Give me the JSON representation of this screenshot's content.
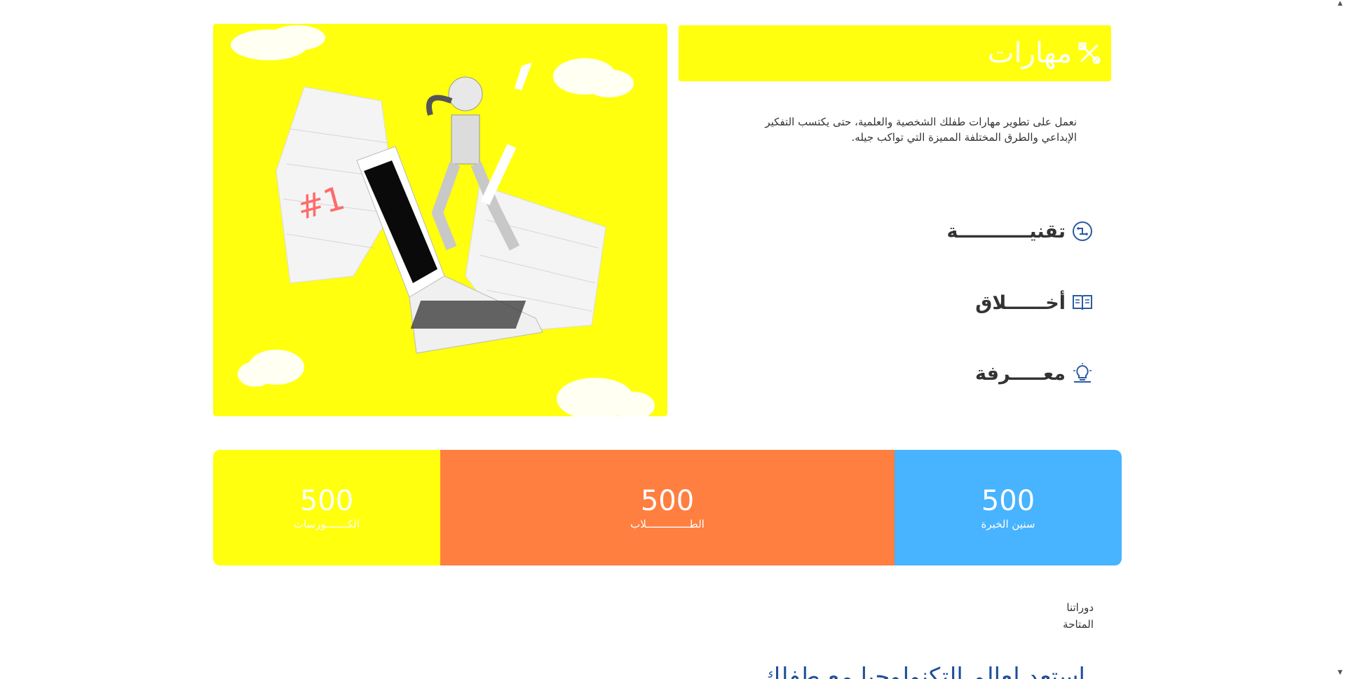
{
  "skills": {
    "title": "مهارات",
    "icon": "tools-icon",
    "description": "نعمل على تطوير مهارات طفلك الشخصية والعلمية، حتى يكتسب التفكير الإبداعي والطرق المختلفة المميزة التي تواكب جيله.",
    "features": [
      {
        "label": "تقنيـــــــــــة",
        "icon": "circuit-brain-icon"
      },
      {
        "label": "أخــــــلاق",
        "icon": "open-book-icon"
      },
      {
        "label": "معـــــرفة",
        "icon": "lightbulb-icon"
      }
    ]
  },
  "stats": [
    {
      "value": "500",
      "label": "الكـــــــورسات",
      "color": "#ffff0e"
    },
    {
      "value": "500",
      "label": "الطــــــــــــــلاب",
      "color": "#ff7f40"
    },
    {
      "value": "500",
      "label": "سنين الخبرة",
      "color": "#48b3ff"
    }
  ],
  "courses": {
    "heading": "دوراتنا المتاحة",
    "next_heading": "استعد لعالم التكنولوجيا مع طفلك"
  },
  "colors": {
    "accent_yellow": "#ffff0e",
    "accent_orange": "#ff7f40",
    "accent_blue": "#48b3ff",
    "heading_blue": "#1e4f9a"
  }
}
